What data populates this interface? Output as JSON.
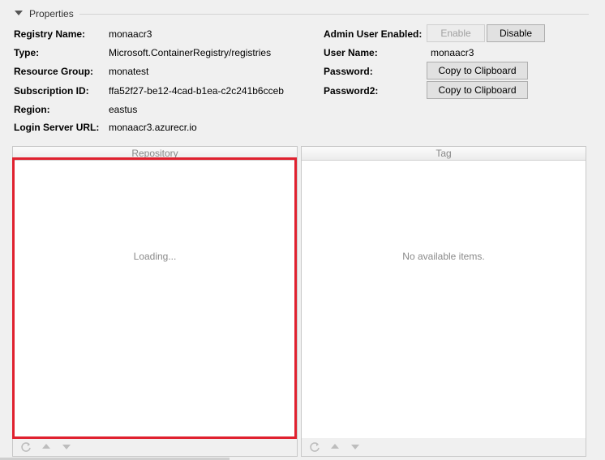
{
  "section": {
    "title": "Properties"
  },
  "properties": {
    "registry_name": {
      "label": "Registry Name:",
      "value": "monaacr3"
    },
    "type": {
      "label": "Type:",
      "value": "Microsoft.ContainerRegistry/registries"
    },
    "resource_group": {
      "label": "Resource Group:",
      "value": "monatest"
    },
    "subscription_id": {
      "label": "Subscription ID:",
      "value": "ffa52f27-be12-4cad-b1ea-c2c241b6cceb"
    },
    "region": {
      "label": "Region:",
      "value": "eastus"
    },
    "login_server": {
      "label": "Login Server URL:",
      "value": "monaacr3.azurecr.io"
    }
  },
  "admin": {
    "enabled_label": "Admin User Enabled:",
    "enable_button": "Enable",
    "disable_button": "Disable",
    "username_label": "User Name:",
    "username_value": "monaacr3",
    "password_label": "Password:",
    "password2_label": "Password2:",
    "copy_button": "Copy to Clipboard"
  },
  "repository_panel": {
    "header": "Repository",
    "message": "Loading..."
  },
  "tag_panel": {
    "header": "Tag",
    "message": "No available items."
  },
  "icons": [
    "refresh-icon",
    "arrow-up-icon",
    "arrow-down-icon"
  ],
  "colors": {
    "highlight": "#e0212f"
  }
}
